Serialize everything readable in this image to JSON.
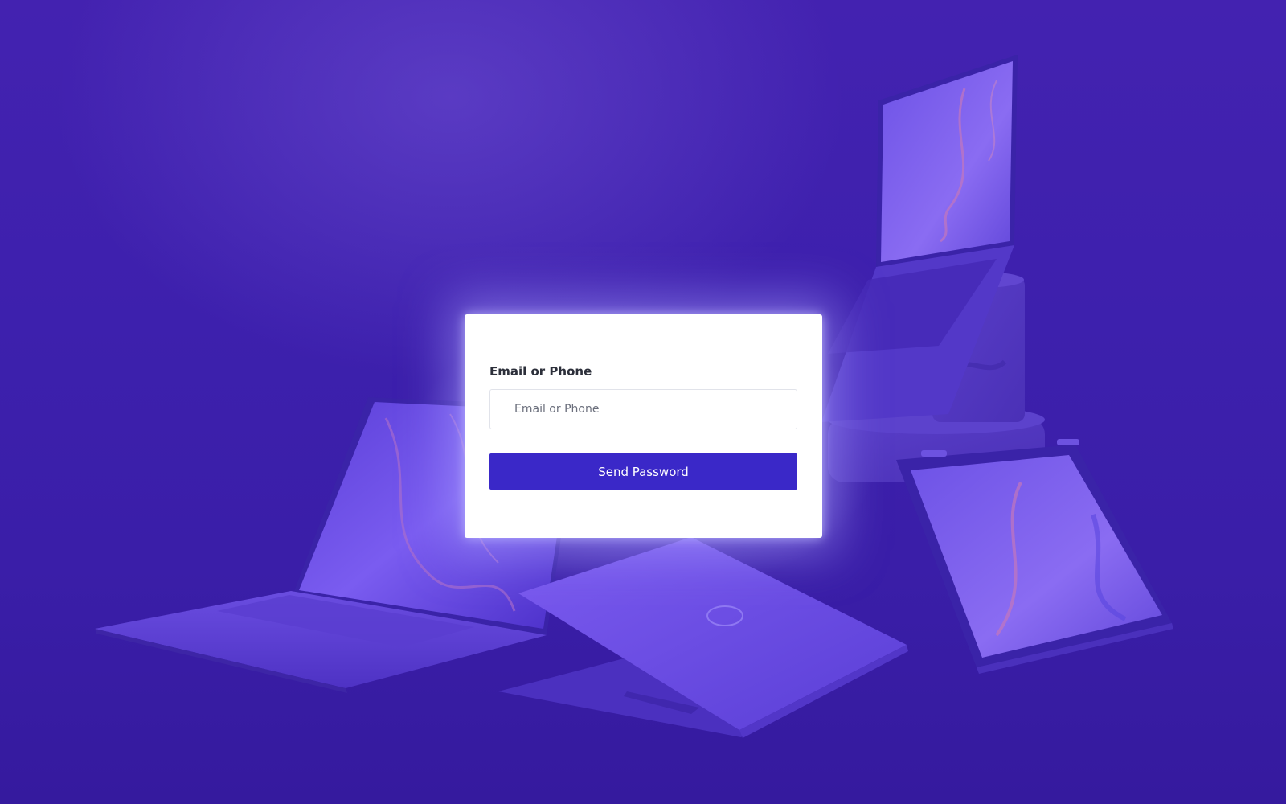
{
  "form": {
    "label": "Email or Phone",
    "input_placeholder": "Email or Phone",
    "input_value": "",
    "submit_label": "Send Password"
  },
  "colors": {
    "background": "#3d20ad",
    "card": "#ffffff",
    "button": "#3a28c8",
    "button_text": "#ffffff",
    "label": "#2c2f3a"
  },
  "icons": {
    "background_image": "laptops-hero-image"
  }
}
